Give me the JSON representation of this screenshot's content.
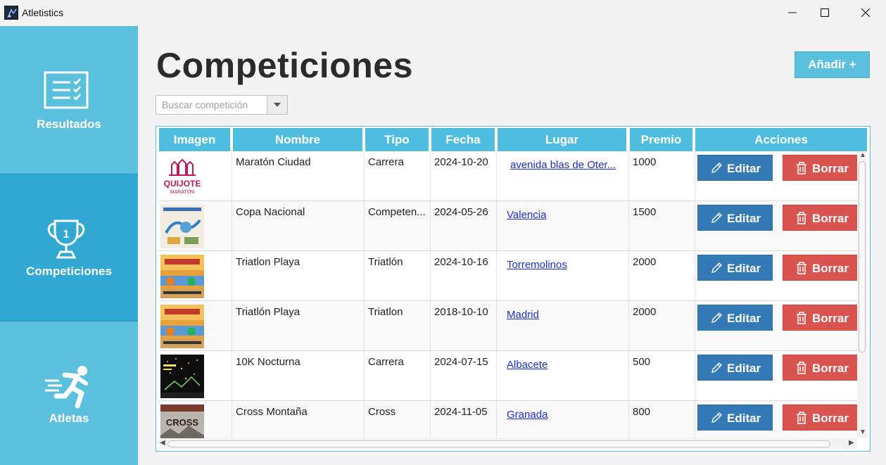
{
  "window": {
    "title": "Atletistics"
  },
  "sidebar": {
    "items": [
      {
        "label": "Resultados",
        "icon": "checklist-icon",
        "active": false
      },
      {
        "label": "Competiciones",
        "icon": "trophy-icon",
        "active": true
      },
      {
        "label": "Atletas",
        "icon": "runner-icon",
        "active": false
      }
    ]
  },
  "main": {
    "title": "Competiciones",
    "add_label": "Añadir +",
    "search_placeholder": "Buscar competición"
  },
  "table": {
    "columns": [
      "Imagen",
      "Nombre",
      "Tipo",
      "Fecha",
      "Lugar",
      "Premio",
      "Acciones"
    ],
    "rows": [
      {
        "image": "quijote-maraton-poster",
        "nombre": "Maratón Ciudad",
        "tipo": "Carrera",
        "fecha": "2024-10-20",
        "lugar": "avenida blas de Oter...",
        "premio": "1000"
      },
      {
        "image": "copa-nacional-poster",
        "nombre": "Copa Nacional",
        "tipo": "Competen...",
        "fecha": "2024-05-26",
        "lugar": "Valencia",
        "premio": "1500"
      },
      {
        "image": "triatlon-poster",
        "nombre": "Triatlon Playa",
        "tipo": "Triatlón",
        "fecha": "2024-10-16",
        "lugar": "Torremolinos",
        "premio": "2000"
      },
      {
        "image": "triatlon-poster",
        "nombre": "Triatlón Playa",
        "tipo": "Triatlon",
        "fecha": "2018-10-10",
        "lugar": "Madrid",
        "premio": "2000"
      },
      {
        "image": "nocturna-poster",
        "nombre": "10K Nocturna",
        "tipo": "Carrera",
        "fecha": "2024-07-15",
        "lugar": "Albacete",
        "premio": "500"
      },
      {
        "image": "cross-poster",
        "nombre": "Cross Montaña",
        "tipo": "Cross",
        "fecha": "2024-11-05",
        "lugar": "Granada",
        "premio": "800"
      }
    ],
    "edit_label": "Editar",
    "delete_label": "Borrar"
  },
  "poster_text": {
    "quijote_title": "QUIJOTE",
    "quijote_sub": "MARATÓN",
    "cross_title": "CROSS"
  },
  "colors": {
    "sidebar": "#5bc0de",
    "sidebar_active": "#31a9d2",
    "header": "#4fbde0",
    "edit": "#337ab7",
    "delete": "#d9534f",
    "link": "#1a2fe0"
  }
}
